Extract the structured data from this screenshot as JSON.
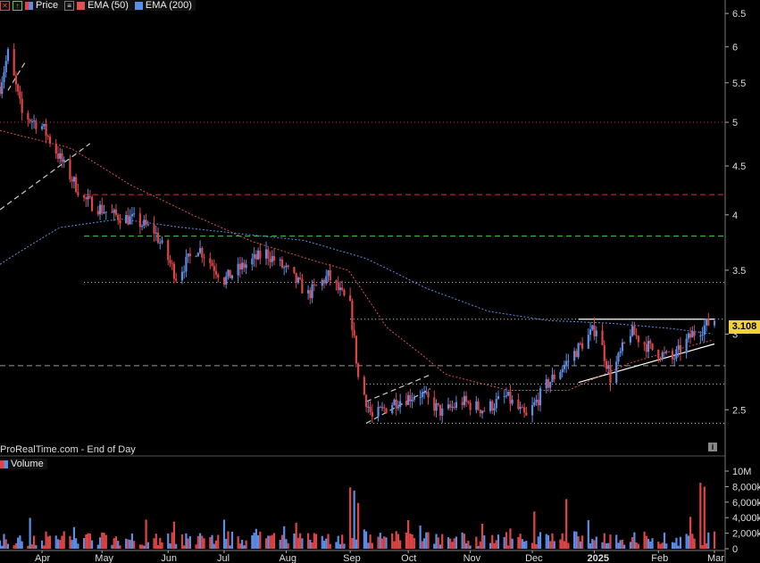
{
  "legend": {
    "price_label": "Price",
    "ema50_label": "EMA (50)",
    "ema200_label": "EMA (200)",
    "colors": {
      "ema50": "#e05050",
      "ema200": "#5b8ee6",
      "up": "#5b8ee6",
      "down": "#e04545"
    }
  },
  "source_text": "ProRealTime.com - End of Day",
  "volume_label": "Volume",
  "last_price_tag": "3.108",
  "price_axis": {
    "ticks": [
      "6.5",
      "6",
      "5.5",
      "5",
      "4.5",
      "4",
      "3.5",
      "3",
      "2.5"
    ]
  },
  "volume_axis": {
    "ticks": [
      "10M",
      "8,000k",
      "6,000k",
      "4,000k",
      "2,000k",
      "0"
    ]
  },
  "time_axis": {
    "ticks": [
      "Apr",
      "May",
      "Jun",
      "Jul",
      "Aug",
      "Sep",
      "Oct",
      "Nov",
      "Dec",
      "2025",
      "Feb",
      "Mar"
    ]
  },
  "chart_data": {
    "type": "candlestick",
    "y_scale": "log",
    "ylim": [
      2.33,
      6.6
    ],
    "x_range": [
      "2024-03-11",
      "2025-03-03"
    ],
    "grid": false,
    "price_path": [
      [
        "2024-03-11",
        5.45
      ],
      [
        "2024-03-15",
        5.9
      ],
      [
        "2024-03-22",
        5.1
      ],
      [
        "2024-04-01",
        4.95
      ],
      [
        "2024-04-12",
        4.5
      ],
      [
        "2024-04-22",
        4.15
      ],
      [
        "2024-05-06",
        4.0
      ],
      [
        "2024-05-17",
        3.95
      ],
      [
        "2024-05-27",
        3.85
      ],
      [
        "2024-06-07",
        3.45
      ],
      [
        "2024-06-18",
        3.7
      ],
      [
        "2024-07-01",
        3.42
      ],
      [
        "2024-07-12",
        3.55
      ],
      [
        "2024-07-22",
        3.65
      ],
      [
        "2024-08-01",
        3.5
      ],
      [
        "2024-08-12",
        3.3
      ],
      [
        "2024-08-22",
        3.45
      ],
      [
        "2024-09-02",
        3.2
      ],
      [
        "2024-09-06",
        2.7
      ],
      [
        "2024-09-13",
        2.45
      ],
      [
        "2024-09-24",
        2.55
      ],
      [
        "2024-10-07",
        2.6
      ],
      [
        "2024-10-18",
        2.48
      ],
      [
        "2024-10-28",
        2.55
      ],
      [
        "2024-11-08",
        2.5
      ],
      [
        "2024-11-19",
        2.58
      ],
      [
        "2024-11-29",
        2.45
      ],
      [
        "2024-12-09",
        2.65
      ],
      [
        "2024-12-19",
        2.8
      ],
      [
        "2025-01-03",
        3.05
      ],
      [
        "2025-01-10",
        2.7
      ],
      [
        "2025-01-20",
        3.02
      ],
      [
        "2025-01-30",
        2.9
      ],
      [
        "2025-02-10",
        2.82
      ],
      [
        "2025-02-20",
        3.0
      ],
      [
        "2025-03-03",
        3.108
      ]
    ],
    "ema50_path": [
      [
        "2024-03-11",
        4.9
      ],
      [
        "2024-04-15",
        4.7
      ],
      [
        "2024-05-15",
        4.3
      ],
      [
        "2024-06-15",
        4.0
      ],
      [
        "2024-07-15",
        3.75
      ],
      [
        "2024-08-15",
        3.58
      ],
      [
        "2024-09-01",
        3.5
      ],
      [
        "2024-09-20",
        3.05
      ],
      [
        "2024-10-20",
        2.72
      ],
      [
        "2024-11-20",
        2.62
      ],
      [
        "2024-12-20",
        2.62
      ],
      [
        "2025-01-20",
        2.8
      ],
      [
        "2025-02-20",
        2.92
      ],
      [
        "2025-03-03",
        2.96
      ]
    ],
    "ema200_path": [
      [
        "2024-03-11",
        3.55
      ],
      [
        "2024-04-10",
        3.88
      ],
      [
        "2024-05-10",
        3.96
      ],
      [
        "2024-06-10",
        3.88
      ],
      [
        "2024-07-10",
        3.82
      ],
      [
        "2024-08-10",
        3.76
      ],
      [
        "2024-09-10",
        3.6
      ],
      [
        "2024-10-10",
        3.35
      ],
      [
        "2024-11-10",
        3.17
      ],
      [
        "2024-12-10",
        3.1
      ],
      [
        "2025-01-10",
        3.08
      ],
      [
        "2025-02-10",
        3.04
      ],
      [
        "2025-03-03",
        3.0
      ]
    ],
    "horizontal_levels": [
      {
        "price": 5.0,
        "style": "dotted",
        "color": "#e03030",
        "from": "2024-03-11"
      },
      {
        "price": 4.2,
        "style": "dashed",
        "color": "#e03030",
        "from": "2024-04-22"
      },
      {
        "price": 3.8,
        "style": "dashed",
        "color": "#4ccf4c",
        "from": "2024-04-22"
      },
      {
        "price": 3.4,
        "style": "dotted",
        "color": "#dddddd",
        "from": "2024-04-22"
      },
      {
        "price": 3.11,
        "style": "dotted",
        "color": "#dddddd",
        "from": "2024-09-02"
      },
      {
        "price": 2.78,
        "style": "dashed",
        "color": "#999999",
        "from": "2024-03-11"
      },
      {
        "price": 2.66,
        "style": "dotted",
        "color": "#dddddd",
        "from": "2024-09-10"
      },
      {
        "price": 2.42,
        "style": "dotted",
        "color": "#dddddd",
        "from": "2024-09-10"
      }
    ],
    "trendlines": [
      {
        "from": [
          "2024-03-11",
          4.05
        ],
        "to": [
          "2024-04-25",
          4.75
        ],
        "color": "#cccccc",
        "style": "dashed"
      },
      {
        "from": [
          "2024-03-15",
          5.4
        ],
        "to": [
          "2024-03-24",
          5.8
        ],
        "color": "#cccccc",
        "style": "dashed"
      },
      {
        "from": [
          "2024-09-10",
          2.42
        ],
        "to": [
          "2024-10-12",
          2.63
        ],
        "color": "#cccccc",
        "style": "dashed"
      },
      {
        "from": [
          "2024-09-10",
          2.55
        ],
        "to": [
          "2024-10-12",
          2.72
        ],
        "color": "#cccccc",
        "style": "dashed"
      },
      {
        "from": [
          "2024-12-25",
          3.11
        ],
        "to": [
          "2025-03-03",
          3.11
        ],
        "color": "#ffffff",
        "style": "solid"
      },
      {
        "from": [
          "2024-12-25",
          2.67
        ],
        "to": [
          "2025-03-03",
          2.93
        ],
        "color": "#ffffff",
        "style": "solid"
      }
    ],
    "volume": {
      "unit": "k",
      "ylim": [
        0,
        10000
      ],
      "spikes": [
        [
          "2024-09-02",
          7900
        ],
        [
          "2024-09-04",
          7500
        ],
        [
          "2024-09-06",
          5900
        ],
        [
          "2024-12-03",
          4800
        ],
        [
          "2024-12-19",
          6400
        ],
        [
          "2025-02-24",
          8500
        ],
        [
          "2025-02-26",
          8000
        ],
        [
          "2025-02-19",
          4100
        ]
      ],
      "baseline": 1200
    }
  }
}
